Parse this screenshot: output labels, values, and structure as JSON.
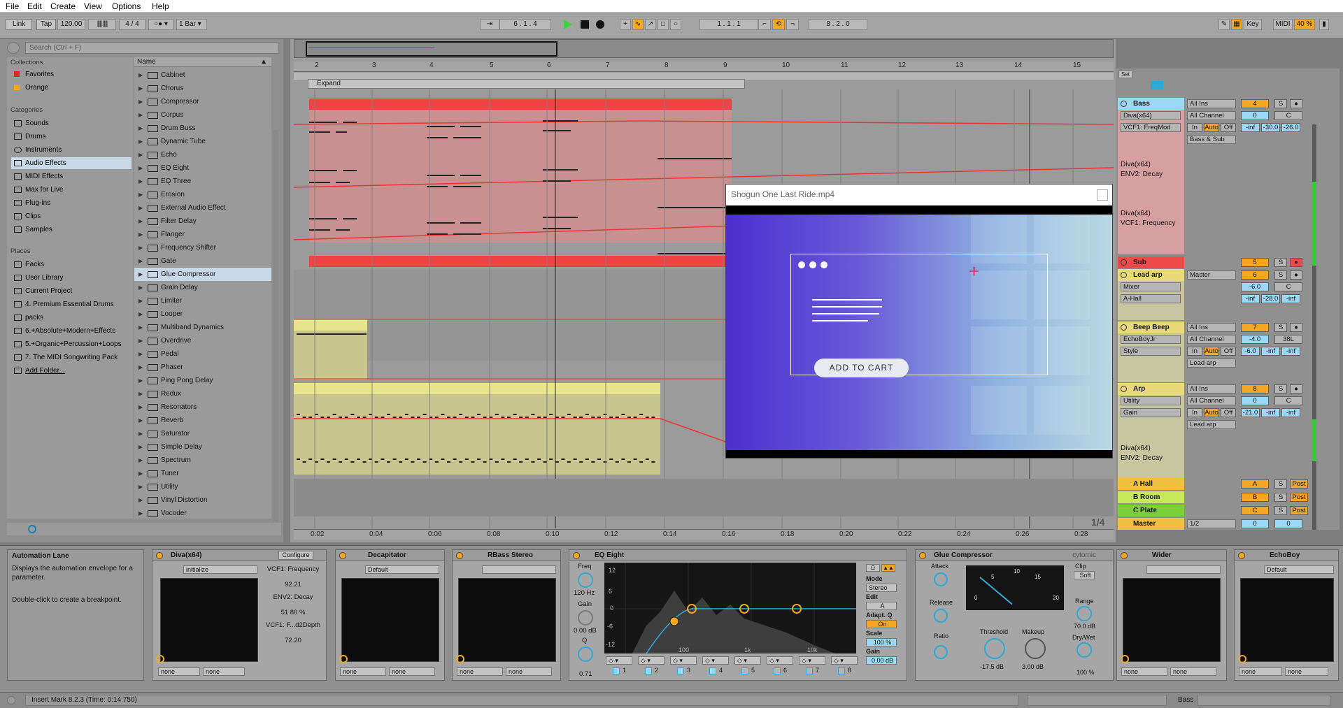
{
  "menu": [
    "File",
    "Edit",
    "Create",
    "View",
    "Options",
    "Help"
  ],
  "transport": {
    "link": "Link",
    "tap": "Tap",
    "tempo": "120.00",
    "signature": "4 / 4",
    "quant": "1 Bar",
    "position": "6 . 1 . 4",
    "loop_start": "1 . 1 . 1",
    "loop_length": "8 . 2 . 0",
    "key_label": "Key",
    "midi_label": "MIDI",
    "cpu": "40 %"
  },
  "browser": {
    "search_placeholder": "Search (Ctrl + F)",
    "collections_title": "Collections",
    "collections": [
      {
        "label": "Favorites",
        "color": "#e02525"
      },
      {
        "label": "Orange",
        "color": "#f5a623"
      }
    ],
    "categories_title": "Categories",
    "categories": [
      "Sounds",
      "Drums",
      "Instruments",
      "Audio Effects",
      "MIDI Effects",
      "Max for Live",
      "Plug-ins",
      "Clips",
      "Samples"
    ],
    "places_title": "Places",
    "places": [
      "Packs",
      "User Library",
      "Current Project",
      "4. Premium Essential Drums",
      "packs",
      "6.+Absolute+Modern+Effects",
      "5.+Organic+Percussion+Loops",
      "7. The MIDI Songwriting Pack",
      "Add Folder..."
    ],
    "name_header": "Name",
    "items": [
      "Cabinet",
      "Chorus",
      "Compressor",
      "Corpus",
      "Drum Buss",
      "Dynamic Tube",
      "Echo",
      "EQ Eight",
      "EQ Three",
      "Erosion",
      "External Audio Effect",
      "Filter Delay",
      "Flanger",
      "Frequency Shifter",
      "Gate",
      "Glue Compressor",
      "Grain Delay",
      "Limiter",
      "Looper",
      "Multiband Dynamics",
      "Overdrive",
      "Pedal",
      "Phaser",
      "Ping Pong Delay",
      "Redux",
      "Resonators",
      "Reverb",
      "Saturator",
      "Simple Delay",
      "Spectrum",
      "Tuner",
      "Utility",
      "Vinyl Distortion",
      "Vocoder"
    ]
  },
  "arrangement": {
    "ruler": [
      "2",
      "3",
      "4",
      "5",
      "6",
      "7",
      "8",
      "9",
      "10",
      "11",
      "12",
      "13",
      "14",
      "15"
    ],
    "expand": "Expand",
    "times": [
      "0:02",
      "0:04",
      "0:06",
      "0:08",
      "0:10",
      "0:12",
      "0:14",
      "0:16",
      "0:18",
      "0:20",
      "0:22",
      "0:24",
      "0:26",
      "0:28"
    ],
    "zoom_fraction": "1/4",
    "clip_dots": "..."
  },
  "mixer": {
    "set_label": "Set",
    "tracks": [
      {
        "name": "Bass",
        "color": "#9ad8f5",
        "input": "All Ins",
        "channel": "All Channel",
        "monitor": [
          "In",
          "Auto",
          "Off"
        ],
        "output": "Bass & Sub",
        "num": "4",
        "vol": "0",
        "pan": "C",
        "extra": [
          "-inf",
          "-30.0",
          "-26.0"
        ],
        "devices": [
          "Diva(x64)",
          "VCF1: FreqMod"
        ]
      },
      {
        "name": "Sub",
        "color": "#ee4a4a",
        "num": "5"
      },
      {
        "name": "Lead arp",
        "color": "#e8d97a",
        "output": "Master",
        "num": "6",
        "vol": "-6.0",
        "pan": "C",
        "extra": [
          "-inf",
          "-28.0",
          "-inf"
        ],
        "devices": [
          "Mixer",
          "A-Hall"
        ]
      },
      {
        "name": "Beep Beep",
        "color": "#e8d97a",
        "input": "All Ins",
        "channel": "All Channel",
        "monitor": [
          "In",
          "Auto",
          "Off"
        ],
        "output": "Lead arp",
        "num": "7",
        "vol": "-4.0",
        "pan": "38L",
        "extra": [
          "-6.0",
          "-inf",
          "-inf"
        ],
        "devices": [
          "EchoBoyJr",
          "Style"
        ]
      },
      {
        "name": "Arp",
        "color": "#e8d97a",
        "input": "All Ins",
        "channel": "All Channel",
        "monitor": [
          "In",
          "Auto",
          "Off"
        ],
        "output": "Lead arp",
        "num": "8",
        "vol": "0",
        "pan": "C",
        "extra": [
          "-21.0",
          "-inf",
          "-inf"
        ],
        "devices": [
          "Utility",
          "Gain"
        ]
      }
    ],
    "automation_labels": [
      "Diva(x64)",
      "ENV2: Decay",
      "Diva(x64)",
      "VCF1: Frequency",
      "Diva(x64)",
      "ENV2: Decay"
    ],
    "returns": [
      {
        "name": "A Hall",
        "color": "#f0c040",
        "num": "A",
        "post": "Post"
      },
      {
        "name": "B Room",
        "color": "#c6e85a",
        "num": "B",
        "post": "Post"
      },
      {
        "name": "C Plate",
        "color": "#7ad03a",
        "num": "C",
        "post": "Post"
      }
    ],
    "master": {
      "name": "Master",
      "color": "#f0c040",
      "output": "1/2",
      "num": "0",
      "pan": "0"
    }
  },
  "video": {
    "title": "Shogun One Last Ride.mp4",
    "cta": "ADD TO CART"
  },
  "info": {
    "title": "Automation Lane",
    "text1": "Displays the automation envelope for a parameter.",
    "text2": "Double-click to create a breakpoint."
  },
  "devices": {
    "diva": {
      "title": "Diva(x64)",
      "configure": "Configure",
      "preset": "initialize",
      "p1": "VCF1: Frequency",
      "v1": "92.21",
      "p2": "ENV2: Decay",
      "v2": "51.80 %",
      "p3": "VCF1: F...d2Depth",
      "v3": "72.20",
      "none": "none"
    },
    "decap": {
      "title": "Decapitator",
      "preset": "Default",
      "none": "none"
    },
    "rbass": {
      "title": "RBass Stereo",
      "none": "none"
    },
    "eq": {
      "title": "EQ Eight",
      "freq_label": "Freq",
      "freq": "120 Hz",
      "gain_label": "Gain",
      "gain": "0.00 dB",
      "q_label": "Q",
      "q": "0.71",
      "mode_label": "Mode",
      "mode": "Stereo",
      "edit_label": "Edit",
      "edit": "A",
      "adaptq_label": "Adapt. Q",
      "adaptq": "On",
      "scale_label": "Scale",
      "scale": "100 %",
      "gain2_label": "Gain",
      "gain2": "0.00 dB",
      "y_ticks": [
        "12",
        "6",
        "0",
        "-6",
        "-12"
      ],
      "x_ticks": [
        "100",
        "1k",
        "10k"
      ],
      "bands": [
        "1",
        "2",
        "3",
        "4",
        "5",
        "6",
        "7",
        "8"
      ]
    },
    "glue": {
      "title": "Glue Compressor",
      "brand": "cytomic",
      "attack_label": "Attack",
      "release_label": "Release",
      "ratio_label": "Ratio",
      "threshold_label": "Threshold",
      "threshold": "-17.5 dB",
      "makeup_label": "Makeup",
      "makeup": "3.00 dB",
      "clip_label": "Clip",
      "soft": "Soft",
      "range_label": "Range",
      "range": "70.0 dB",
      "drywet_label": "Dry/Wet",
      "drywet": "100 %",
      "meter": [
        "0",
        "5",
        "10",
        "15",
        "20"
      ]
    },
    "wider": {
      "title": "Wider",
      "none": "none"
    },
    "echoboy": {
      "title": "EchoBoy",
      "preset": "Default",
      "none": "none"
    }
  },
  "status": {
    "text": "Insert Mark 8.2.3 (Time: 0:14:750)",
    "track": "Bass"
  }
}
